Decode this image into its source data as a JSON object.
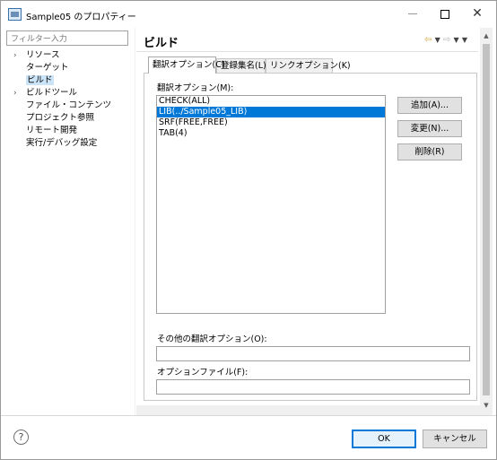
{
  "window": {
    "title": "Sample05 のプロパティー"
  },
  "filter": {
    "placeholder": "フィルター入力"
  },
  "tree": {
    "items": [
      {
        "label": "リソース",
        "expandable": true,
        "selected": false
      },
      {
        "label": "ターゲット",
        "expandable": false,
        "selected": false
      },
      {
        "label": "ビルド",
        "expandable": false,
        "selected": true
      },
      {
        "label": "ビルドツール",
        "expandable": true,
        "selected": false
      },
      {
        "label": "ファイル・コンテンツ",
        "expandable": false,
        "selected": false
      },
      {
        "label": "プロジェクト参照",
        "expandable": false,
        "selected": false
      },
      {
        "label": "リモート開発",
        "expandable": false,
        "selected": false
      },
      {
        "label": "実行/デバッグ設定",
        "expandable": false,
        "selected": false
      }
    ]
  },
  "page": {
    "title": "ビルド",
    "nav": {
      "back": "⇦",
      "forward": "⇨",
      "menu": "▼"
    }
  },
  "tabs": [
    {
      "label": "翻訳オプション(C)",
      "active": true
    },
    {
      "label": "登録集名(L)",
      "active": false
    },
    {
      "label": "リンクオプション(K)",
      "active": false
    }
  ],
  "options": {
    "label": "翻訳オプション(M):",
    "items": [
      {
        "text": "CHECK(ALL)",
        "selected": false
      },
      {
        "text": "LIB(../Sample05_LIB)",
        "selected": true
      },
      {
        "text": "SRF(FREE,FREE)",
        "selected": false
      },
      {
        "text": "TAB(4)",
        "selected": false
      }
    ],
    "buttons": {
      "add": "追加(A)...",
      "change": "変更(N)...",
      "delete": "削除(R)"
    },
    "other_label": "その他の翻訳オプション(O):",
    "other_value": "",
    "option_file_label": "オプションファイル(F):",
    "option_file_value": ""
  },
  "footer": {
    "help": "?",
    "ok": "OK",
    "cancel": "キャンセル"
  },
  "colors": {
    "selection": "#0078d7",
    "tree_selection": "#cce4f7",
    "nav_arrow": "#d7a339"
  }
}
